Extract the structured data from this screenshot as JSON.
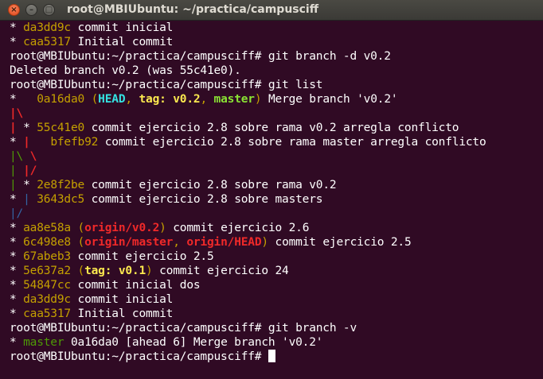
{
  "window": {
    "title": "root@MBIUbuntu: ~/practica/campusciff",
    "close_glyph": "×",
    "min_glyph": "–",
    "max_glyph": "□"
  },
  "colors": {
    "background": "#300a24",
    "yellow": "#c4a000",
    "red_bold": "#ef2929",
    "green": "#4e9a06",
    "cyan_bold": "#34e2e2",
    "blue": "#3465a4"
  },
  "terminal": {
    "lines": [
      [
        {
          "t": "* "
        },
        {
          "t": "da3dd9c",
          "c": "y"
        },
        {
          "t": " commit inicial"
        }
      ],
      [
        {
          "t": "* "
        },
        {
          "t": "caa5317",
          "c": "y"
        },
        {
          "t": " Initial commit"
        }
      ],
      [
        {
          "t": "root@MBIUbuntu:~/practica/campusciff# git branch -d v0.2"
        }
      ],
      [
        {
          "t": "Deleted branch v0.2 (was 55c41e0)."
        }
      ],
      [
        {
          "t": "root@MBIUbuntu:~/practica/campusciff# git list"
        }
      ],
      [
        {
          "t": "*   "
        },
        {
          "t": "0a16da0",
          "c": "y"
        },
        {
          "t": " (",
          "c": "y"
        },
        {
          "t": "HEAD",
          "c": "cy"
        },
        {
          "t": ", ",
          "c": "y"
        },
        {
          "t": "tag: v0.2",
          "c": "ybold"
        },
        {
          "t": ", ",
          "c": "y"
        },
        {
          "t": "master",
          "c": "gb"
        },
        {
          "t": ")",
          "c": "y"
        },
        {
          "t": " Merge branch 'v0.2'"
        }
      ],
      [
        {
          "t": "|\\",
          "c": "r"
        }
      ],
      [
        {
          "t": "|",
          "c": "r"
        },
        {
          "t": " * "
        },
        {
          "t": "55c41e0",
          "c": "y"
        },
        {
          "t": " commit ejercicio 2.8 sobre rama v0.2 arregla conflicto"
        }
      ],
      [
        {
          "t": "* "
        },
        {
          "t": "|",
          "c": "r"
        },
        {
          "t": "   "
        },
        {
          "t": "bfefb92",
          "c": "y"
        },
        {
          "t": " commit ejercicio 2.8 sobre rama master arregla conflicto"
        }
      ],
      [
        {
          "t": "|\\",
          "c": "g"
        },
        {
          "t": " "
        },
        {
          "t": "\\",
          "c": "r"
        }
      ],
      [
        {
          "t": "|",
          "c": "g"
        },
        {
          "t": " "
        },
        {
          "t": "|/",
          "c": "r"
        }
      ],
      [
        {
          "t": "|",
          "c": "g"
        },
        {
          "t": " * "
        },
        {
          "t": "2e8f2be",
          "c": "y"
        },
        {
          "t": " commit ejercicio 2.8 sobre rama v0.2"
        }
      ],
      [
        {
          "t": "* "
        },
        {
          "t": "|",
          "c": "b"
        },
        {
          "t": " "
        },
        {
          "t": "3643dc5",
          "c": "y"
        },
        {
          "t": " commit ejercicio 2.8 sobre masters"
        }
      ],
      [
        {
          "t": "|/",
          "c": "b"
        }
      ],
      [
        {
          "t": "* "
        },
        {
          "t": "aa8e58a",
          "c": "y"
        },
        {
          "t": " (",
          "c": "y"
        },
        {
          "t": "origin/v0.2",
          "c": "r"
        },
        {
          "t": ")",
          "c": "y"
        },
        {
          "t": " commit ejercicio 2.6"
        }
      ],
      [
        {
          "t": "* "
        },
        {
          "t": "6c498e8",
          "c": "y"
        },
        {
          "t": " (",
          "c": "y"
        },
        {
          "t": "origin/master",
          "c": "r"
        },
        {
          "t": ", ",
          "c": "y"
        },
        {
          "t": "origin/HEAD",
          "c": "r"
        },
        {
          "t": ")",
          "c": "y"
        },
        {
          "t": " commit ejercicio 2.5"
        }
      ],
      [
        {
          "t": "* "
        },
        {
          "t": "67abeb3",
          "c": "y"
        },
        {
          "t": " commit ejercicio 2.5"
        }
      ],
      [
        {
          "t": "* "
        },
        {
          "t": "5e637a2",
          "c": "y"
        },
        {
          "t": " (",
          "c": "y"
        },
        {
          "t": "tag: v0.1",
          "c": "ybold"
        },
        {
          "t": ")",
          "c": "y"
        },
        {
          "t": " commit ejercicio 24"
        }
      ],
      [
        {
          "t": "* "
        },
        {
          "t": "54847cc",
          "c": "y"
        },
        {
          "t": " commit inicial dos"
        }
      ],
      [
        {
          "t": "* "
        },
        {
          "t": "da3dd9c",
          "c": "y"
        },
        {
          "t": " commit inicial"
        }
      ],
      [
        {
          "t": "* "
        },
        {
          "t": "caa5317",
          "c": "y"
        },
        {
          "t": " Initial commit"
        }
      ],
      [
        {
          "t": "root@MBIUbuntu:~/practica/campusciff# git branch -v"
        }
      ],
      [
        {
          "t": "* "
        },
        {
          "t": "master",
          "c": "g"
        },
        {
          "t": " 0a16da0 [ahead 6] Merge branch 'v0.2'"
        }
      ]
    ],
    "prompt": "root@MBIUbuntu:~/practica/campusciff# "
  }
}
